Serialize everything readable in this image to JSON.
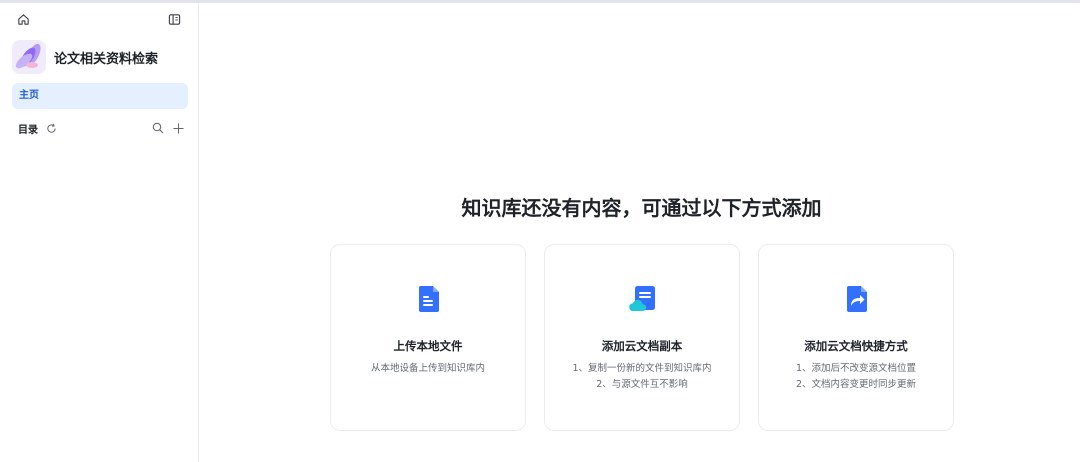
{
  "sidebar": {
    "home_icon": "home-icon",
    "collapse_icon": "sidebar-collapse-icon",
    "kb_title": "论文相关资料检索",
    "nav_home": "主页",
    "catalog_label": "目录",
    "refresh_icon": "refresh-icon",
    "search_icon": "search-icon",
    "add_icon": "plus-icon"
  },
  "main": {
    "headline": "知识库还没有内容，可通过以下方式添加",
    "cards": [
      {
        "title": "上传本地文件",
        "lines": [
          "从本地设备上传到知识库内"
        ],
        "icon": "document-icon",
        "color": "#3370ff"
      },
      {
        "title": "添加云文档副本",
        "lines": [
          "1、复制一份新的文件到知识库内",
          "2、与源文件互不影响"
        ],
        "icon": "cloud-doc-icon",
        "color": "#3370ff"
      },
      {
        "title": "添加云文档快捷方式",
        "lines": [
          "1、添加后不改变源文档位置",
          "2、文档内容变更时同步更新"
        ],
        "icon": "shortcut-doc-icon",
        "color": "#3370ff"
      }
    ]
  }
}
